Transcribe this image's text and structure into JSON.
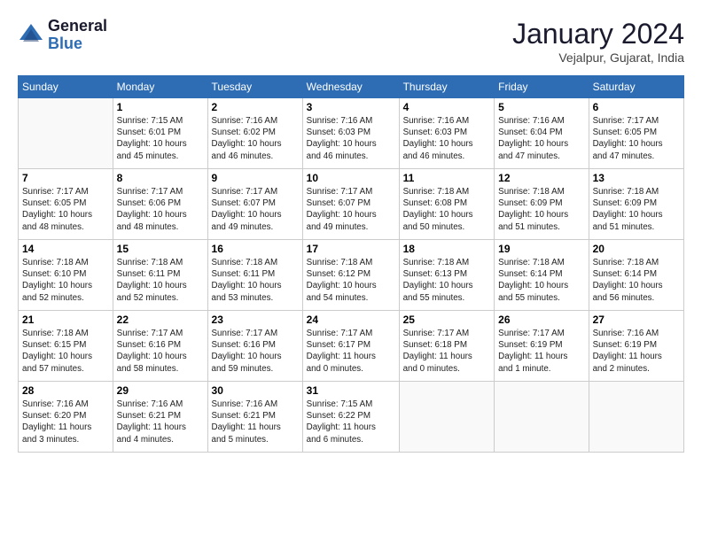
{
  "logo": {
    "general": "General",
    "blue": "Blue"
  },
  "title": "January 2024",
  "location": "Vejalpur, Gujarat, India",
  "headers": [
    "Sunday",
    "Monday",
    "Tuesday",
    "Wednesday",
    "Thursday",
    "Friday",
    "Saturday"
  ],
  "weeks": [
    [
      {
        "num": "",
        "info": ""
      },
      {
        "num": "1",
        "info": "Sunrise: 7:15 AM\nSunset: 6:01 PM\nDaylight: 10 hours\nand 45 minutes."
      },
      {
        "num": "2",
        "info": "Sunrise: 7:16 AM\nSunset: 6:02 PM\nDaylight: 10 hours\nand 46 minutes."
      },
      {
        "num": "3",
        "info": "Sunrise: 7:16 AM\nSunset: 6:03 PM\nDaylight: 10 hours\nand 46 minutes."
      },
      {
        "num": "4",
        "info": "Sunrise: 7:16 AM\nSunset: 6:03 PM\nDaylight: 10 hours\nand 46 minutes."
      },
      {
        "num": "5",
        "info": "Sunrise: 7:16 AM\nSunset: 6:04 PM\nDaylight: 10 hours\nand 47 minutes."
      },
      {
        "num": "6",
        "info": "Sunrise: 7:17 AM\nSunset: 6:05 PM\nDaylight: 10 hours\nand 47 minutes."
      }
    ],
    [
      {
        "num": "7",
        "info": "Sunrise: 7:17 AM\nSunset: 6:05 PM\nDaylight: 10 hours\nand 48 minutes."
      },
      {
        "num": "8",
        "info": "Sunrise: 7:17 AM\nSunset: 6:06 PM\nDaylight: 10 hours\nand 48 minutes."
      },
      {
        "num": "9",
        "info": "Sunrise: 7:17 AM\nSunset: 6:07 PM\nDaylight: 10 hours\nand 49 minutes."
      },
      {
        "num": "10",
        "info": "Sunrise: 7:17 AM\nSunset: 6:07 PM\nDaylight: 10 hours\nand 49 minutes."
      },
      {
        "num": "11",
        "info": "Sunrise: 7:18 AM\nSunset: 6:08 PM\nDaylight: 10 hours\nand 50 minutes."
      },
      {
        "num": "12",
        "info": "Sunrise: 7:18 AM\nSunset: 6:09 PM\nDaylight: 10 hours\nand 51 minutes."
      },
      {
        "num": "13",
        "info": "Sunrise: 7:18 AM\nSunset: 6:09 PM\nDaylight: 10 hours\nand 51 minutes."
      }
    ],
    [
      {
        "num": "14",
        "info": "Sunrise: 7:18 AM\nSunset: 6:10 PM\nDaylight: 10 hours\nand 52 minutes."
      },
      {
        "num": "15",
        "info": "Sunrise: 7:18 AM\nSunset: 6:11 PM\nDaylight: 10 hours\nand 52 minutes."
      },
      {
        "num": "16",
        "info": "Sunrise: 7:18 AM\nSunset: 6:11 PM\nDaylight: 10 hours\nand 53 minutes."
      },
      {
        "num": "17",
        "info": "Sunrise: 7:18 AM\nSunset: 6:12 PM\nDaylight: 10 hours\nand 54 minutes."
      },
      {
        "num": "18",
        "info": "Sunrise: 7:18 AM\nSunset: 6:13 PM\nDaylight: 10 hours\nand 55 minutes."
      },
      {
        "num": "19",
        "info": "Sunrise: 7:18 AM\nSunset: 6:14 PM\nDaylight: 10 hours\nand 55 minutes."
      },
      {
        "num": "20",
        "info": "Sunrise: 7:18 AM\nSunset: 6:14 PM\nDaylight: 10 hours\nand 56 minutes."
      }
    ],
    [
      {
        "num": "21",
        "info": "Sunrise: 7:18 AM\nSunset: 6:15 PM\nDaylight: 10 hours\nand 57 minutes."
      },
      {
        "num": "22",
        "info": "Sunrise: 7:17 AM\nSunset: 6:16 PM\nDaylight: 10 hours\nand 58 minutes."
      },
      {
        "num": "23",
        "info": "Sunrise: 7:17 AM\nSunset: 6:16 PM\nDaylight: 10 hours\nand 59 minutes."
      },
      {
        "num": "24",
        "info": "Sunrise: 7:17 AM\nSunset: 6:17 PM\nDaylight: 11 hours\nand 0 minutes."
      },
      {
        "num": "25",
        "info": "Sunrise: 7:17 AM\nSunset: 6:18 PM\nDaylight: 11 hours\nand 0 minutes."
      },
      {
        "num": "26",
        "info": "Sunrise: 7:17 AM\nSunset: 6:19 PM\nDaylight: 11 hours\nand 1 minute."
      },
      {
        "num": "27",
        "info": "Sunrise: 7:16 AM\nSunset: 6:19 PM\nDaylight: 11 hours\nand 2 minutes."
      }
    ],
    [
      {
        "num": "28",
        "info": "Sunrise: 7:16 AM\nSunset: 6:20 PM\nDaylight: 11 hours\nand 3 minutes."
      },
      {
        "num": "29",
        "info": "Sunrise: 7:16 AM\nSunset: 6:21 PM\nDaylight: 11 hours\nand 4 minutes."
      },
      {
        "num": "30",
        "info": "Sunrise: 7:16 AM\nSunset: 6:21 PM\nDaylight: 11 hours\nand 5 minutes."
      },
      {
        "num": "31",
        "info": "Sunrise: 7:15 AM\nSunset: 6:22 PM\nDaylight: 11 hours\nand 6 minutes."
      },
      {
        "num": "",
        "info": ""
      },
      {
        "num": "",
        "info": ""
      },
      {
        "num": "",
        "info": ""
      }
    ]
  ]
}
